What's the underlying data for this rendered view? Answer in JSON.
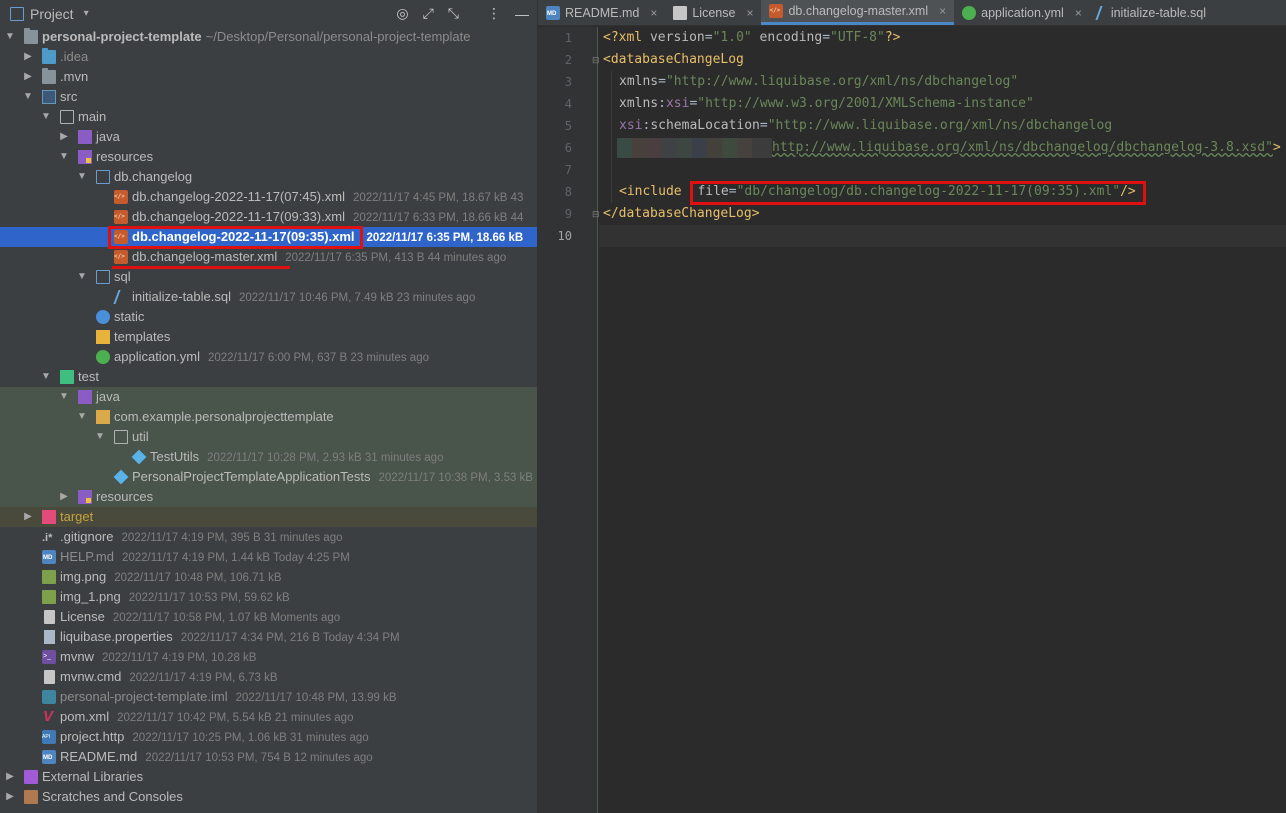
{
  "project_panel": {
    "title": "Project",
    "tree": [
      {
        "name": "personal-project-template",
        "path": "~/Desktop/Personal/personal-project-template",
        "meta": ""
      },
      {
        "name": ".idea",
        "meta": ""
      },
      {
        "name": ".mvn",
        "meta": ""
      },
      {
        "name": "src",
        "meta": ""
      },
      {
        "name": "main",
        "meta": ""
      },
      {
        "name": "java",
        "meta": ""
      },
      {
        "name": "resources",
        "meta": ""
      },
      {
        "name": "db.changelog",
        "meta": ""
      },
      {
        "name": "db.changelog-2022-11-17(07:45).xml",
        "meta": "2022/11/17 4:45 PM, 18.67 kB 43"
      },
      {
        "name": "db.changelog-2022-11-17(09:33).xml",
        "meta": "2022/11/17 6:33 PM, 18.66 kB 44"
      },
      {
        "name": "db.changelog-2022-11-17(09:35).xml",
        "meta": "2022/11/17 6:35 PM, 18.66 kB"
      },
      {
        "name": "db.changelog-master.xml",
        "meta": "2022/11/17 6:35 PM, 413 B 44 minutes ago"
      },
      {
        "name": "sql",
        "meta": ""
      },
      {
        "name": "initialize-table.sql",
        "meta": "2022/11/17 10:46 PM, 7.49 kB 23 minutes ago"
      },
      {
        "name": "static",
        "meta": ""
      },
      {
        "name": "templates",
        "meta": ""
      },
      {
        "name": "application.yml",
        "meta": "2022/11/17 6:00 PM, 637 B 23 minutes ago"
      },
      {
        "name": "test",
        "meta": ""
      },
      {
        "name": "java",
        "meta": ""
      },
      {
        "name": "com.example.personalprojecttemplate",
        "meta": ""
      },
      {
        "name": "util",
        "meta": ""
      },
      {
        "name": "TestUtils",
        "meta": "2022/11/17 10:28 PM, 2.93 kB 31 minutes ago"
      },
      {
        "name": "PersonalProjectTemplateApplicationTests",
        "meta": "2022/11/17 10:38 PM, 3.53 kB"
      },
      {
        "name": "resources",
        "meta": ""
      },
      {
        "name": "target",
        "meta": ""
      },
      {
        "name": ".gitignore",
        "meta": "2022/11/17 4:19 PM, 395 B 31 minutes ago"
      },
      {
        "name": "HELP.md",
        "meta": "2022/11/17 4:19 PM, 1.44 kB Today 4:25 PM"
      },
      {
        "name": "img.png",
        "meta": "2022/11/17 10:48 PM, 106.71 kB"
      },
      {
        "name": "img_1.png",
        "meta": "2022/11/17 10:53 PM, 59.62 kB"
      },
      {
        "name": "License",
        "meta": "2022/11/17 10:58 PM, 1.07 kB Moments ago"
      },
      {
        "name": "liquibase.properties",
        "meta": "2022/11/17 4:34 PM, 216 B Today 4:34 PM"
      },
      {
        "name": "mvnw",
        "meta": "2022/11/17 4:19 PM, 10.28 kB"
      },
      {
        "name": "mvnw.cmd",
        "meta": "2022/11/17 4:19 PM, 6.73 kB"
      },
      {
        "name": "personal-project-template.iml",
        "meta": "2022/11/17 10:48 PM, 13.99 kB"
      },
      {
        "name": "pom.xml",
        "meta": "2022/11/17 10:42 PM, 5.54 kB 21 minutes ago"
      },
      {
        "name": "project.http",
        "meta": "2022/11/17 10:25 PM, 1.06 kB 31 minutes ago"
      },
      {
        "name": "README.md",
        "meta": "2022/11/17 10:53 PM, 754 B 12 minutes ago"
      },
      {
        "name": "External Libraries",
        "meta": ""
      },
      {
        "name": "Scratches and Consoles",
        "meta": ""
      }
    ]
  },
  "editor": {
    "tabs": [
      {
        "label": "README.md",
        "icon": "markdown-icon",
        "active": false
      },
      {
        "label": "License",
        "icon": "text-file-icon",
        "active": false
      },
      {
        "label": "db.changelog-master.xml",
        "icon": "xml-file-icon",
        "active": true
      },
      {
        "label": "application.yml",
        "icon": "spring-config-icon",
        "active": false
      },
      {
        "label": "initialize-table.sql",
        "icon": "sql-file-icon",
        "active": false
      }
    ],
    "line_numbers": [
      "1",
      "2",
      "3",
      "4",
      "5",
      "6",
      "7",
      "8",
      "9",
      "10"
    ],
    "current_line": "10",
    "code": {
      "l1": {
        "open": "<?",
        "xml": "xml ",
        "version_attr": "version",
        "eq1": "=",
        "version_val": "\"1.0\"",
        "enc_attr": " encoding",
        "eq2": "=",
        "enc_val": "\"UTF-8\"",
        "close": "?>"
      },
      "l2": {
        "tag": "<databaseChangeLog"
      },
      "l3": {
        "attr": "xmlns",
        "eq": "=",
        "val": "\"http://www.liquibase.org/xml/ns/dbchangelog\""
      },
      "l4": {
        "ns": "xmlns",
        "colon": ":",
        "attr": "xsi",
        "eq": "=",
        "val": "\"http://www.w3.org/2001/XMLSchema-instance\""
      },
      "l5": {
        "ns": "xsi",
        "colon": ":",
        "attr": "schemaLocation",
        "eq": "=",
        "val": "\"http://www.liquibase.org/xml/ns/dbchangelog"
      },
      "l6": {
        "val": "http://www.liquibase.org/xml/ns/dbchangelog/dbchangelog-3.8.xsd\"",
        "close": ">"
      },
      "l8": {
        "tag": "<include",
        "attr": "file",
        "eq": "=",
        "val": "\"db/changelog/db.changelog-2022-11-17(09:35).xml\"",
        "close": "/>"
      },
      "l9": {
        "tag": "</databaseChangeLog>"
      }
    }
  },
  "colors": {
    "selection": "#2f65ca",
    "annotation_red": "#e01010",
    "xml_tag": "#e8bf6a",
    "xml_string": "#6a8759",
    "xml_namespace": "#9876aa"
  }
}
